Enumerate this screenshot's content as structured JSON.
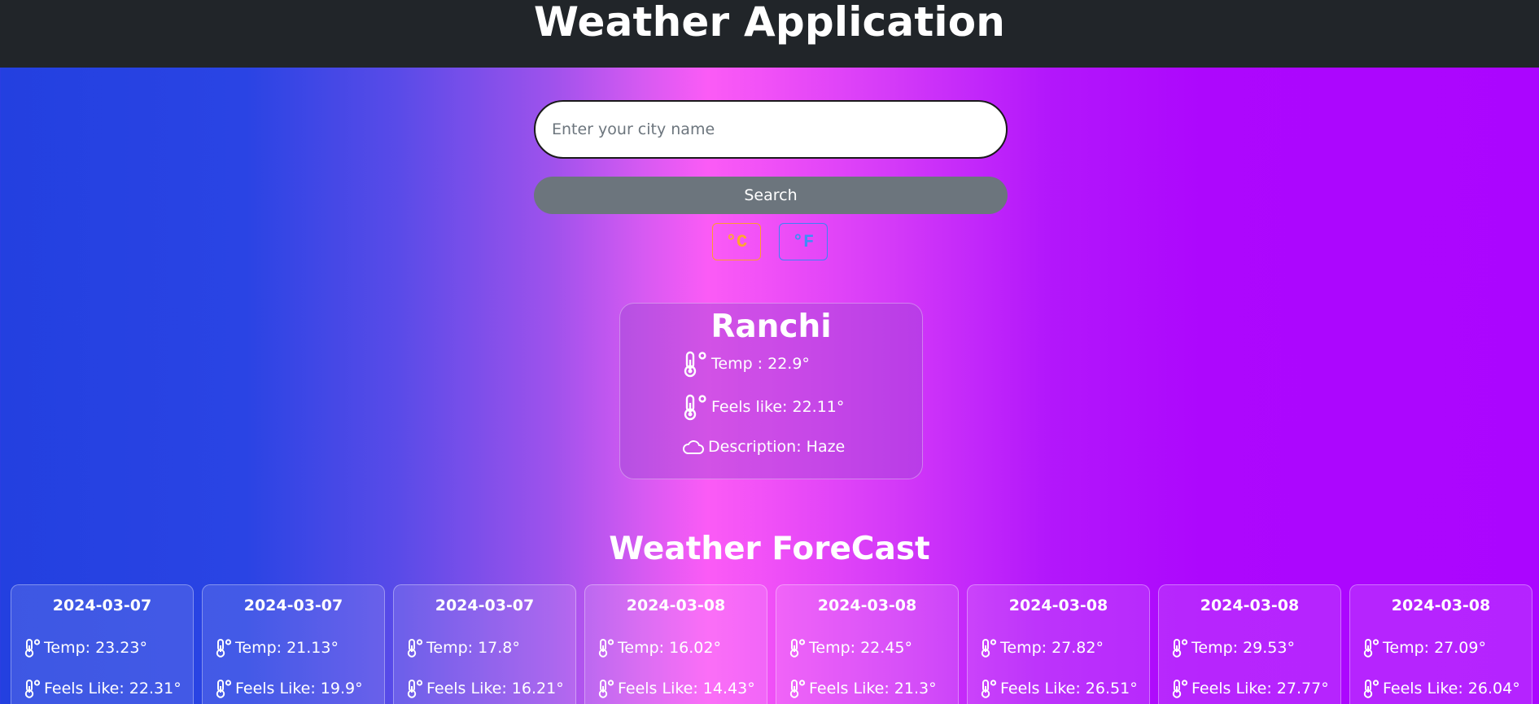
{
  "header": {
    "title": "Weather Application"
  },
  "search": {
    "placeholder": "Enter your city name",
    "value": "",
    "button_label": "Search"
  },
  "units": {
    "celsius_label": "°C",
    "fahrenheit_label": "°F",
    "celsius_color": "#ffa72e",
    "fahrenheit_color": "#3d8ef6"
  },
  "current": {
    "city": "Ranchi",
    "temp": "Temp : 22.9°",
    "feels_like": "Feels like: 22.11°",
    "description": "Description: Haze",
    "temp_icon": "thermometer-icon",
    "desc_icon": "cloud-icon"
  },
  "forecast": {
    "title": "Weather ForeCast",
    "items": [
      {
        "date": "2024-03-07",
        "temp": "Temp: 23.23°",
        "feels_like": "Feels Like: 22.31°"
      },
      {
        "date": "2024-03-07",
        "temp": "Temp: 21.13°",
        "feels_like": "Feels Like: 19.9°"
      },
      {
        "date": "2024-03-07",
        "temp": "Temp: 17.8°",
        "feels_like": "Feels Like: 16.21°"
      },
      {
        "date": "2024-03-08",
        "temp": "Temp: 16.02°",
        "feels_like": "Feels Like: 14.43°"
      },
      {
        "date": "2024-03-08",
        "temp": "Temp: 22.45°",
        "feels_like": "Feels Like: 21.3°"
      },
      {
        "date": "2024-03-08",
        "temp": "Temp: 27.82°",
        "feels_like": "Feels Like: 26.51°"
      },
      {
        "date": "2024-03-08",
        "temp": "Temp: 29.53°",
        "feels_like": "Feels Like: 27.77°"
      },
      {
        "date": "2024-03-08",
        "temp": "Temp: 27.09°",
        "feels_like": "Feels Like: 26.04°"
      }
    ]
  }
}
